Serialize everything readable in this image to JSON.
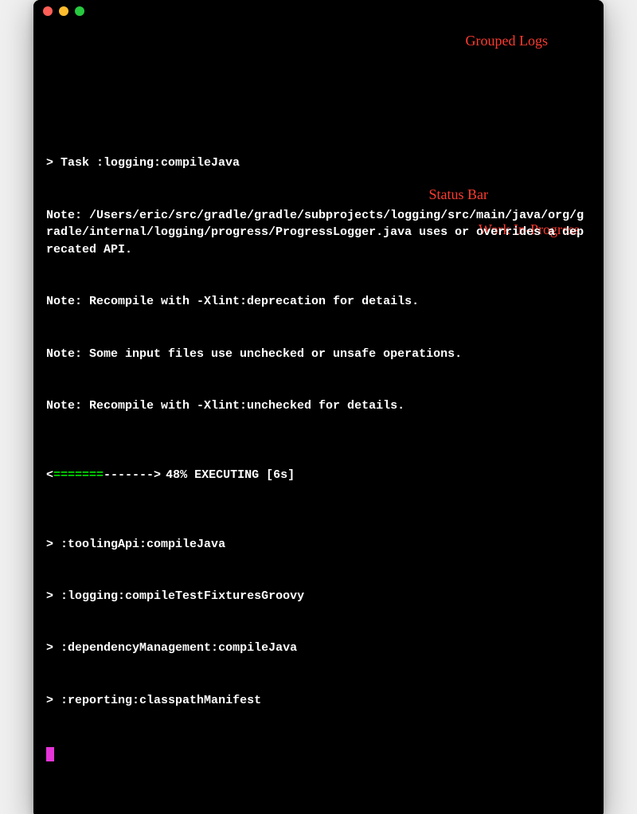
{
  "titlebar": {
    "close": "close",
    "minimize": "minimize",
    "maximize": "maximize"
  },
  "annotations": {
    "grouped_logs": "Grouped Logs",
    "status_bar": "Status Bar",
    "work_in_progress": "Work In-Progress"
  },
  "log": {
    "task_header": "> Task :logging:compileJava",
    "note1": "Note: /Users/eric/src/gradle/gradle/subprojects/logging/src/main/java/org/gradle/internal/logging/progress/ProgressLogger.java uses or overrides a deprecated API.",
    "note2": "Note: Recompile with -Xlint:deprecation for details.",
    "note3": "Note: Some input files use unchecked or unsafe operations.",
    "note4": "Note: Recompile with -Xlint:unchecked for details."
  },
  "progress": {
    "arrow_left": "<",
    "filled": "=======",
    "empty": "-------",
    "arrow_right": ">",
    "text": "48% EXECUTING [6s]"
  },
  "tasks": [
    {
      "chevron": ">",
      "name": ":toolingApi:compileJava"
    },
    {
      "chevron": ">",
      "name": ":logging:compileTestFixturesGroovy"
    },
    {
      "chevron": ">",
      "name": ":dependencyManagement:compileJava"
    },
    {
      "chevron": ">",
      "name": ":reporting:classpathManifest"
    }
  ]
}
